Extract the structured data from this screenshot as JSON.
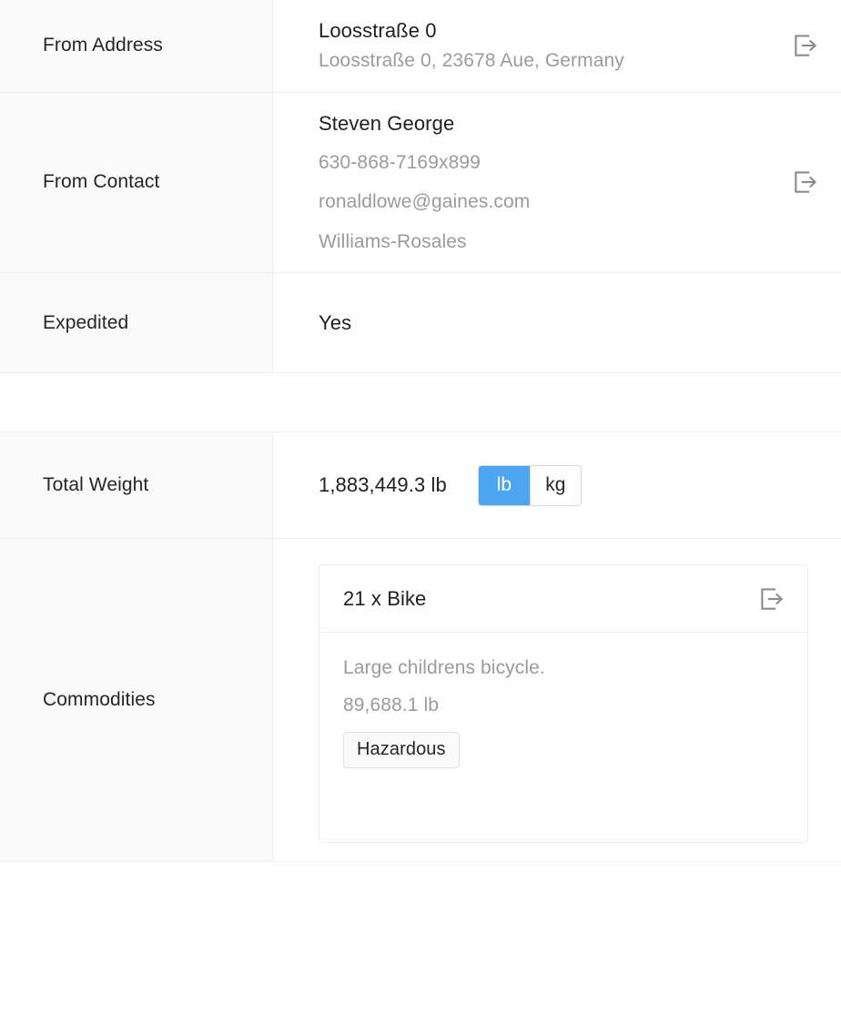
{
  "sections": [
    {
      "id": "shipment-origin",
      "rows": [
        {
          "id": "from-address",
          "label": "From Address",
          "primary": "Loosstraße 0",
          "secondary": [
            "Loosstraße 0, 23678 Aue, Germany"
          ],
          "action_icon": "open-external-icon"
        },
        {
          "id": "from-contact",
          "label": "From Contact",
          "primary": "Steven George",
          "secondary": [
            "630-868-7169x899",
            "ronaldlowe@gaines.com",
            "Williams-Rosales"
          ],
          "action_icon": "open-external-icon"
        },
        {
          "id": "expedited",
          "label": "Expedited",
          "primary": "Yes",
          "secondary": [],
          "action_icon": null
        }
      ]
    },
    {
      "id": "shipment-load",
      "rows": [
        {
          "id": "total-weight",
          "label": "Total Weight",
          "primary": "1,883,449.3 lb"
        },
        {
          "id": "commodities",
          "label": "Commodities"
        }
      ]
    }
  ],
  "weight_toggle": {
    "options": [
      {
        "id": "lb",
        "label": "lb",
        "active": true
      },
      {
        "id": "kg",
        "label": "kg",
        "active": false
      }
    ],
    "active_color": "#4fa6f0",
    "active_text_color": "#ffffff"
  },
  "commodities": [
    {
      "id": "commodity-bike",
      "title": "21 x Bike",
      "description": "Large childrens bicycle.",
      "weight": "89,688.1 lb",
      "badges": [
        "Hazardous"
      ],
      "action_icon": "open-external-icon"
    }
  ],
  "colors": {
    "label_background": "#fafafa",
    "border": "#eeeeee",
    "primary_text": "#1f1f1f",
    "muted_text": "#9b9b9b",
    "icon": "#8c8c8c",
    "accent": "#4fa6f0"
  }
}
